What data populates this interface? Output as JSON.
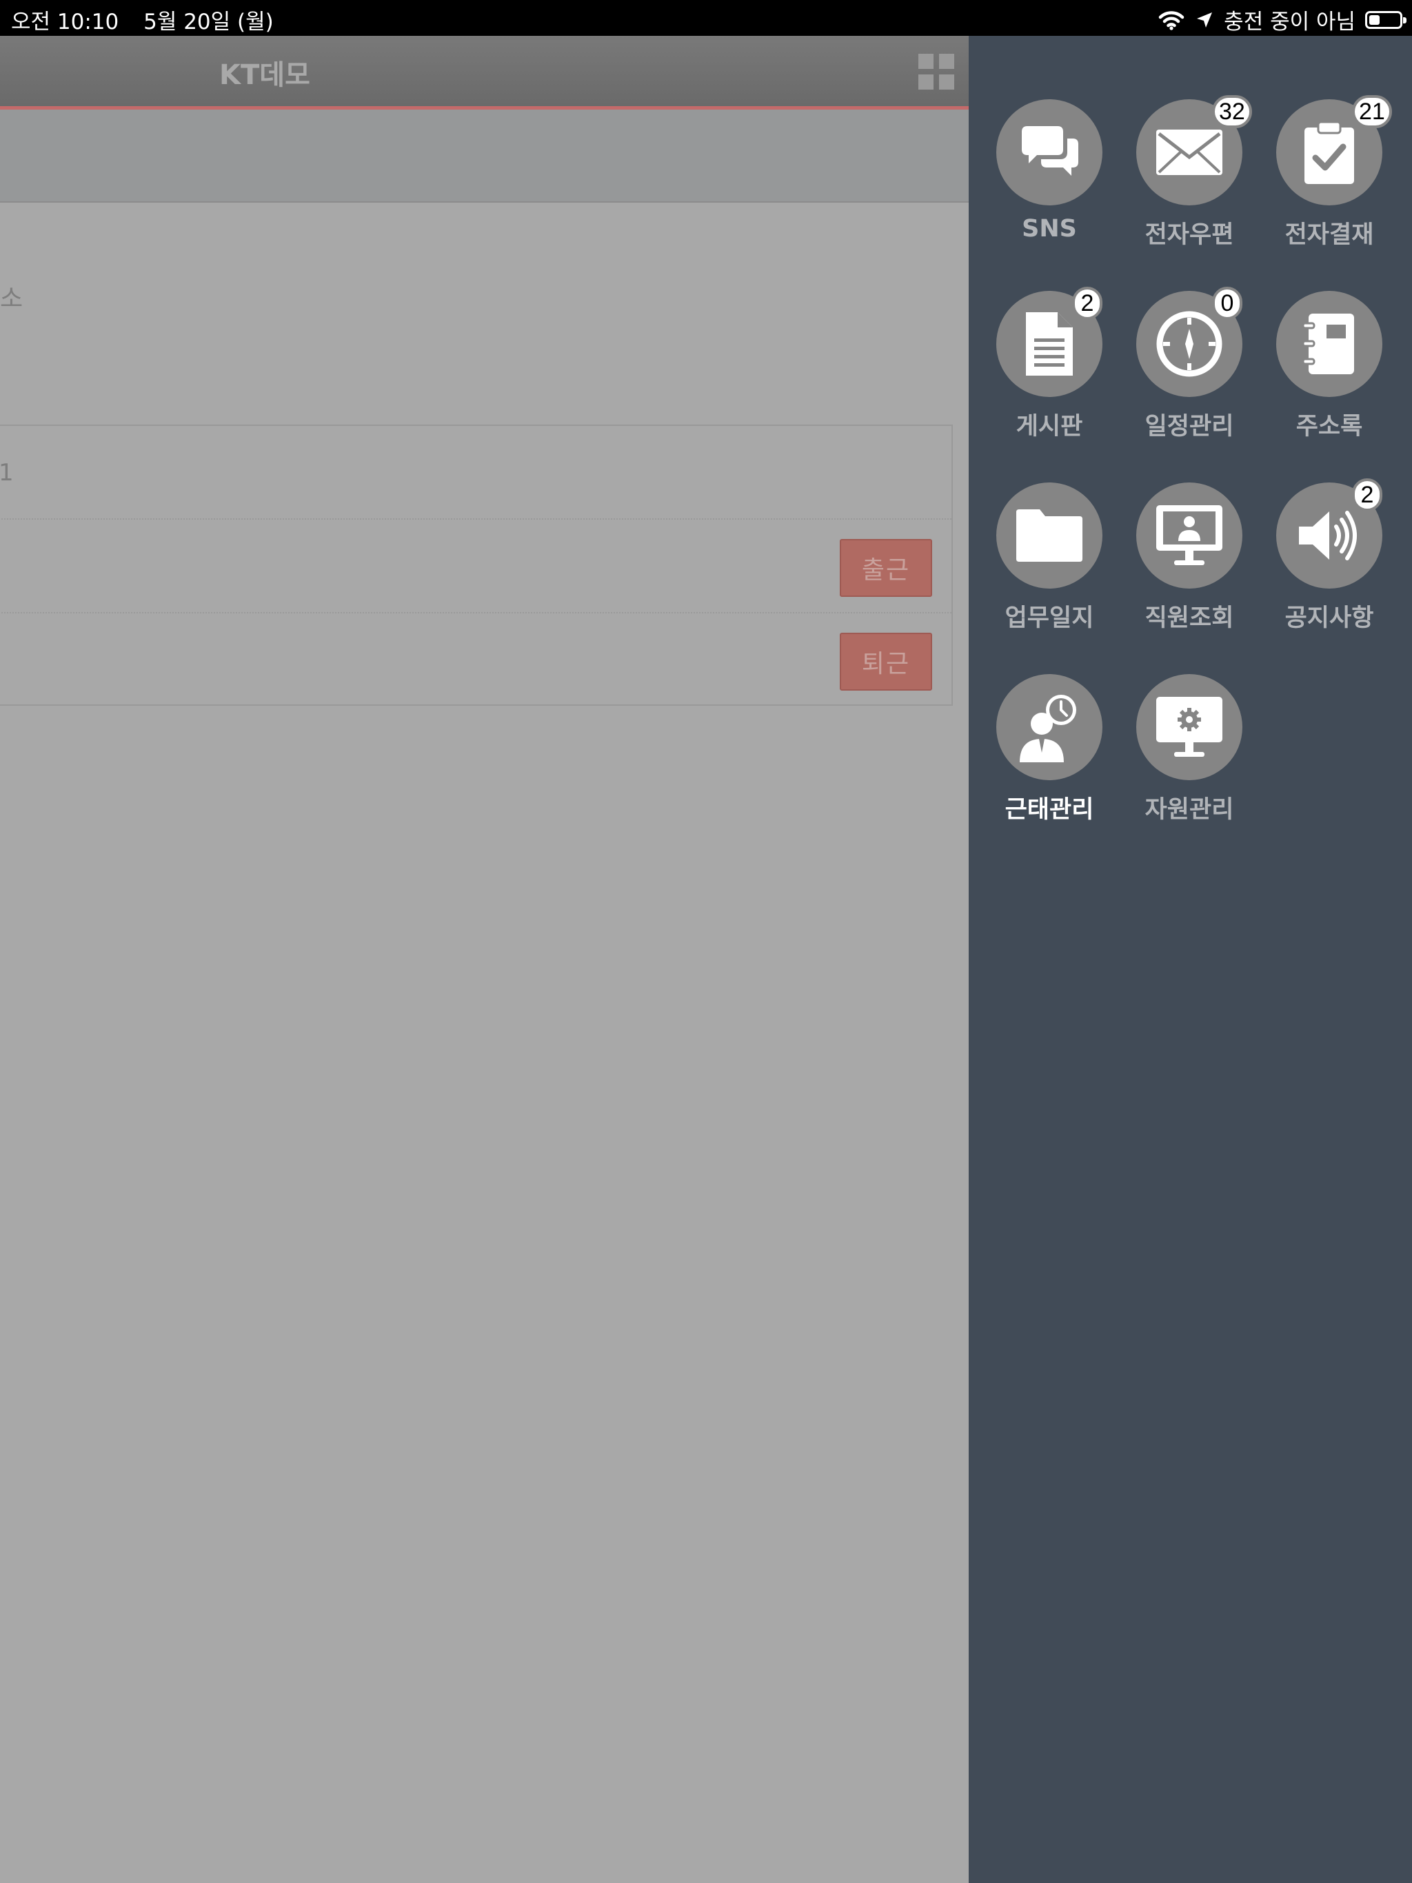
{
  "status_bar": {
    "time": "오전 10:10",
    "date": "5월 20일 (월)",
    "charging": "충전 중이 아님",
    "battery_level": 0.35
  },
  "app": {
    "title": "KT데모",
    "fragment_top": "소",
    "fragment_row": "1",
    "clock_in_label": "출근",
    "clock_out_label": "퇴근"
  },
  "drawer": {
    "items": [
      {
        "label": "SNS",
        "icon": "chat-bubbles-icon",
        "badge": ""
      },
      {
        "label": "전자우편",
        "icon": "envelope-icon",
        "badge": "32"
      },
      {
        "label": "전자결재",
        "icon": "clipboard-check-icon",
        "badge": "21"
      },
      {
        "label": "게시판",
        "icon": "document-icon",
        "badge": "2"
      },
      {
        "label": "일정관리",
        "icon": "compass-icon",
        "badge": "0"
      },
      {
        "label": "주소록",
        "icon": "address-book-icon",
        "badge": ""
      },
      {
        "label": "업무일지",
        "icon": "folder-icon",
        "badge": ""
      },
      {
        "label": "직원조회",
        "icon": "monitor-person-icon",
        "badge": ""
      },
      {
        "label": "공지사항",
        "icon": "megaphone-icon",
        "badge": "2"
      },
      {
        "label": "근태관리",
        "icon": "person-clock-icon",
        "badge": "",
        "active": true
      },
      {
        "label": "자원관리",
        "icon": "monitor-gear-icon",
        "badge": ""
      }
    ]
  },
  "colors": {
    "drawer_bg": "#414b57",
    "icon_circle": "#858585",
    "accent_red": "#c46a6a"
  }
}
